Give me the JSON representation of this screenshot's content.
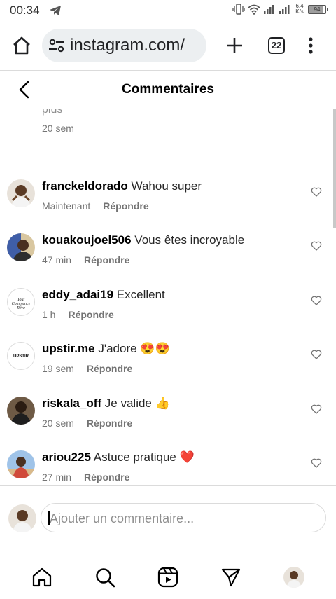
{
  "status_bar": {
    "time": "00:34",
    "net_speed_value": "6,4",
    "net_speed_unit": "K/s",
    "battery": "94",
    "battery_level": 0.94
  },
  "browser": {
    "url": "instagram.com/",
    "tab_count": "22"
  },
  "header": {
    "title": "Commentaires"
  },
  "previous_comment": {
    "text_fragment": "plus",
    "time": "20 sem"
  },
  "comments": [
    {
      "username": "franckeldorado",
      "text": "Wahou super",
      "time": "Maintenant",
      "reply_label": "Répondre",
      "avatar_color": "#c9a57c"
    },
    {
      "username": "kouakoujoel506",
      "text": "Vous êtes incroyable",
      "time": "47 min",
      "reply_label": "Répondre",
      "avatar_color": "#5a6fa8"
    },
    {
      "username": "eddy_adai19",
      "text": "Excellent",
      "time": "1 h",
      "reply_label": "Répondre",
      "avatar_color": "#ffffff"
    },
    {
      "username": "upstir.me",
      "text": "J'adore 😍😍",
      "time": "19 sem",
      "reply_label": "Répondre",
      "avatar_color": "#ffffff"
    },
    {
      "username": "riskala_off",
      "text": "Je valide 👍",
      "time": "20 sem",
      "reply_label": "Répondre",
      "avatar_color": "#4a3b2e"
    },
    {
      "username": "ariou225",
      "text": "Astuce pratique ❤️",
      "time": "27 min",
      "reply_label": "Répondre",
      "avatar_color": "#d04a3a"
    }
  ],
  "avatar_texts": {
    "eddy_adai19": "Tout Commence Rêve",
    "upstir": "UPSTIR"
  },
  "input": {
    "placeholder": "Ajouter un commentaire..."
  },
  "bottom_nav": [
    {
      "icon": "home-icon"
    },
    {
      "icon": "search-icon"
    },
    {
      "icon": "reels-icon"
    },
    {
      "icon": "send-icon"
    },
    {
      "icon": "profile-avatar"
    }
  ],
  "colors": {
    "text_secondary": "#737373",
    "border": "#dbdbdb",
    "url_bg": "#eceff1"
  }
}
